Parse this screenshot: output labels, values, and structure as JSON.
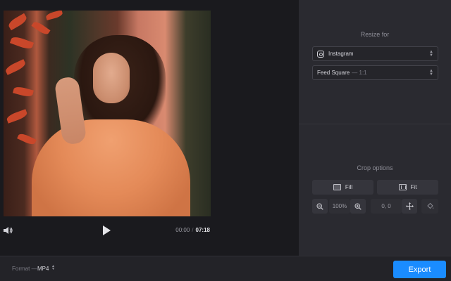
{
  "player": {
    "current_time": "00:00",
    "separator": "/",
    "total_time": "07:18"
  },
  "resize": {
    "title": "Resize for",
    "platform": {
      "icon": "instagram-icon",
      "value": "Instagram"
    },
    "preset": {
      "value": "Feed Square",
      "suffix": "— 1:1"
    }
  },
  "crop": {
    "title": "Crop options",
    "fill_label": "Fill",
    "fit_label": "Fit",
    "zoom_value": "100%",
    "position_value": "0, 0"
  },
  "bottom": {
    "format_label": "Format —",
    "format_value": "MP4",
    "export_label": "Export"
  },
  "colors": {
    "accent": "#1a8cff",
    "panel": "#2a2a30",
    "background": "#1a1a1e"
  }
}
